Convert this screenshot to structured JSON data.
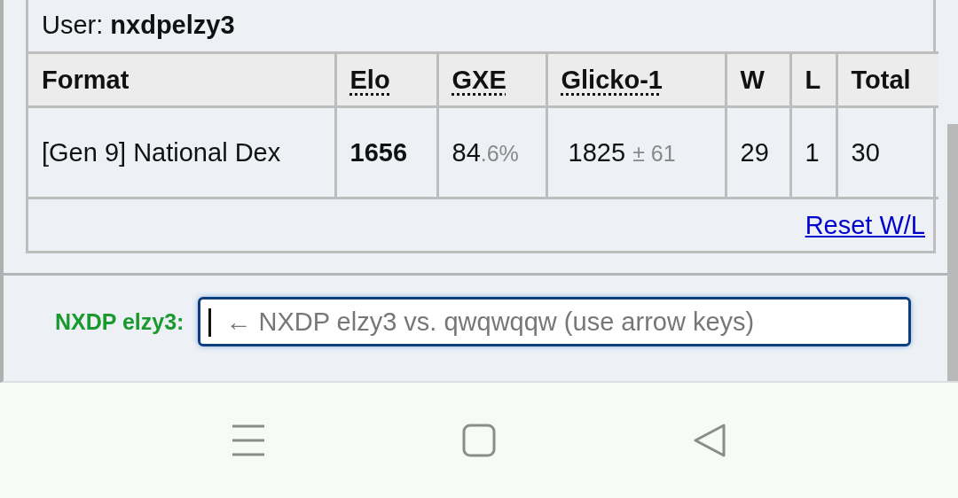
{
  "user": {
    "label": "User:",
    "name": "nxdpelzy3"
  },
  "table": {
    "columns": [
      {
        "label": "Format",
        "kind": "plain"
      },
      {
        "label": "Elo",
        "kind": "abbr"
      },
      {
        "label": "GXE",
        "kind": "abbr"
      },
      {
        "label": "Glicko-1",
        "kind": "abbr"
      },
      {
        "label": "W",
        "kind": "plain"
      },
      {
        "label": "L",
        "kind": "plain"
      },
      {
        "label": "Total",
        "kind": "plain"
      }
    ],
    "rows": [
      {
        "format": "[Gen 9] National Dex",
        "elo": "1656",
        "gxe": {
          "whole": "84",
          "fraction": ".6%"
        },
        "glicko": {
          "rating": "1825",
          "deviation": "± 61"
        },
        "wins": "29",
        "losses": "1",
        "total": "30"
      }
    ],
    "reset_link": "Reset W/L"
  },
  "chat": {
    "label": "NXDP elzy3:",
    "placeholder": "← NXDP elzy3 vs. qwqwqqw (use arrow keys)",
    "focused": true
  },
  "nav_bar": [
    {
      "kind": "menu"
    },
    {
      "kind": "home"
    },
    {
      "kind": "back"
    }
  ]
}
